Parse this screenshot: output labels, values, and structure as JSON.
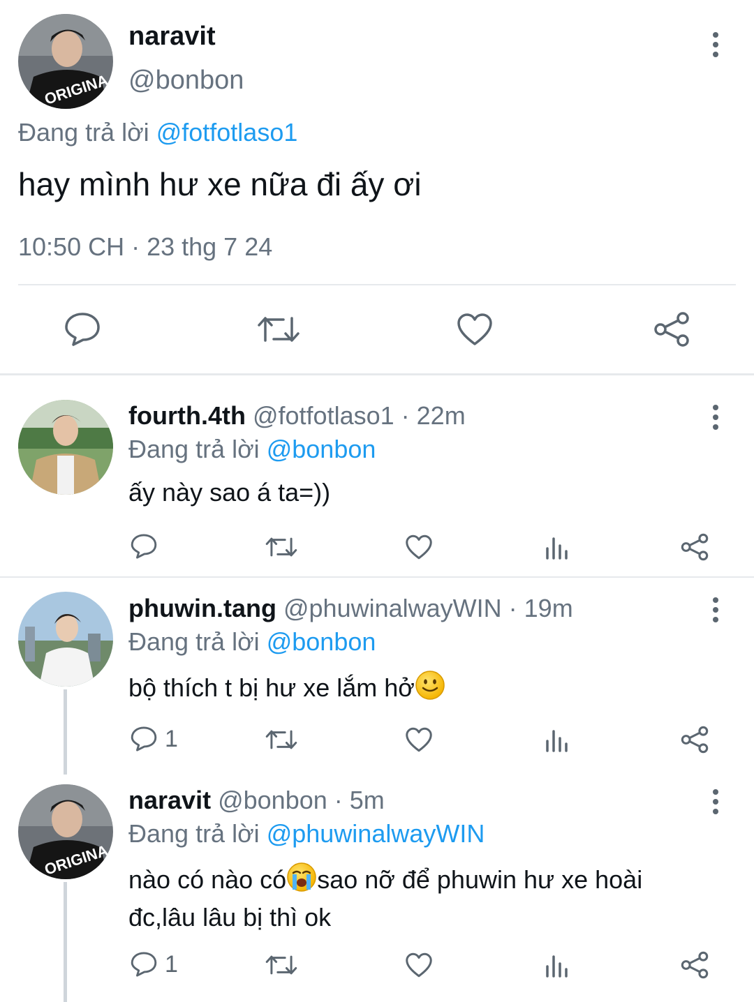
{
  "main_tweet": {
    "display_name": "naravit",
    "handle": "@bonbon",
    "replying_prefix": "Đang trả lời",
    "replying_to": "@fotfotlaso1",
    "text": "hay mình hư xe nữa đi ấy ơi",
    "timestamp": "10:50 CH · 23 thg 7 24",
    "actions": [
      "reply-icon",
      "retweet-icon",
      "like-icon",
      "share-icon"
    ]
  },
  "replies": [
    {
      "display_name": "fourth.4th",
      "handle": "@fotfotlaso1",
      "time": "· 22m",
      "replying_prefix": "Đang trả lời",
      "replying_to": "@bonbon",
      "text": "ấy này sao á ta=))",
      "reply_count": ""
    },
    {
      "display_name": "phuwin.tang",
      "handle": "@phuwinalwayWIN",
      "time": "· 19m",
      "replying_prefix": "Đang trả lời",
      "replying_to": "@bonbon",
      "text": "bộ thích t bị hư xe lắm hở",
      "emoji": "slightly-smiling-face",
      "reply_count": "1"
    },
    {
      "display_name": "naravit",
      "handle": "@bonbon",
      "time": "· 5m",
      "replying_prefix": "Đang trả lời",
      "replying_to": "@phuwinalwayWIN",
      "text_part1": "nào có nào có",
      "emoji": "loudly-crying-face",
      "text_part2": "sao nỡ để phuwin hư xe hoài",
      "text_line2": "đc,lâu lâu bị thì ok",
      "reply_count": "1"
    }
  ],
  "colors": {
    "accent": "#1d9bf0",
    "secondary_text": "#66727f",
    "divider": "#e6e9ec"
  }
}
